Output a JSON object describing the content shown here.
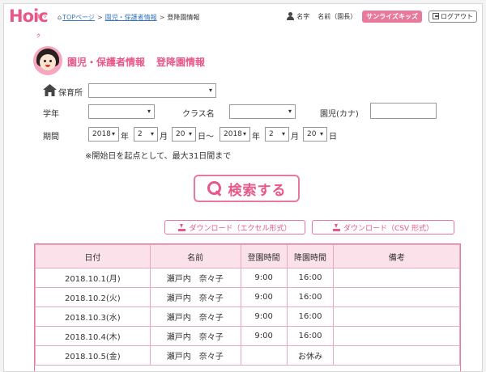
{
  "header": {
    "logo": "Hoic",
    "logo_sub": "ホイック",
    "breadcrumb": {
      "home": "TOPページ",
      "parent": "園児・保護者情報",
      "current": "登降園情報",
      "sep": ">"
    },
    "user_label": "名字",
    "user_name": "名前（園長）",
    "school": "サンライズキッズ",
    "logout": "ログアウト"
  },
  "title": {
    "part1": "園児・保護者情報",
    "part2": "登降園情報"
  },
  "form": {
    "nursery_label": "保育所",
    "nursery_value": "",
    "grade_label": "学年",
    "grade_value": "",
    "class_label": "クラス名",
    "class_value": "",
    "kana_label": "園児(カナ)",
    "kana_value": "",
    "period_label": "期間",
    "start_year": "2018",
    "start_month": "2",
    "start_day": "20",
    "end_year": "2018",
    "end_month": "2",
    "end_day": "20",
    "unit_year": "年",
    "unit_month": "月",
    "unit_day": "日",
    "range_sep": "日～",
    "note": "※開始日を起点として、最大31日間まで"
  },
  "search_button": "検索する",
  "downloads": {
    "excel": "ダウンロード（エクセル形式）",
    "csv": "ダウンロード（CSV 形式）"
  },
  "table": {
    "headers": [
      "日付",
      "名前",
      "登園時間",
      "降園時間",
      "備考"
    ],
    "rows": [
      [
        "2018.10.1(月)",
        "瀬戸内　奈々子",
        "9:00",
        "16:00",
        ""
      ],
      [
        "2018.10.2(火)",
        "瀬戸内　奈々子",
        "9:00",
        "16:00",
        ""
      ],
      [
        "2018.10.3(水)",
        "瀬戸内　奈々子",
        "9:00",
        "16:00",
        ""
      ],
      [
        "2018.10.4(木)",
        "瀬戸内　奈々子",
        "9:00",
        "16:00",
        ""
      ],
      [
        "2018.10.5(金)",
        "瀬戸内　奈々子",
        "",
        "お休み",
        ""
      ]
    ]
  },
  "colors": {
    "accent": "#e8578a",
    "accent_light": "#fbe1ea",
    "badge": "#e8799b",
    "link": "#3b77b8"
  },
  "icons": [
    "home-icon",
    "person-icon",
    "logout-icon",
    "house-icon",
    "search-icon",
    "download-icon",
    "avatar-girl-icon"
  ]
}
